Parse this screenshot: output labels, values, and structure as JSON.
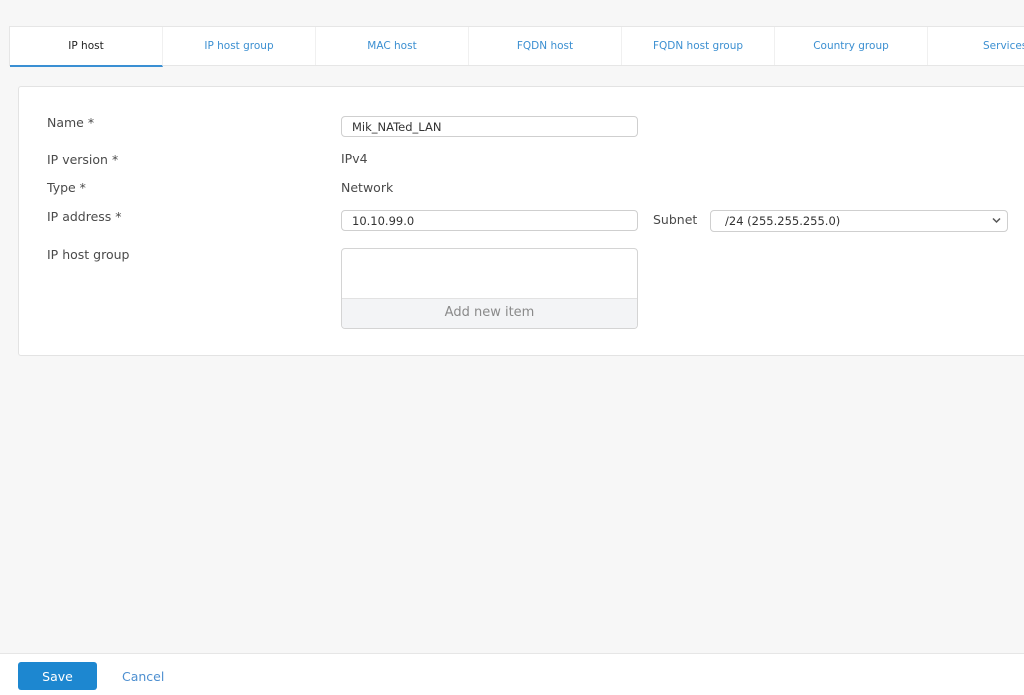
{
  "tabs": [
    {
      "label": "IP host",
      "active": true
    },
    {
      "label": "IP host group",
      "active": false
    },
    {
      "label": "MAC host",
      "active": false
    },
    {
      "label": "FQDN host",
      "active": false
    },
    {
      "label": "FQDN host group",
      "active": false
    },
    {
      "label": "Country group",
      "active": false
    },
    {
      "label": "Services",
      "active": false
    }
  ],
  "form": {
    "name": {
      "label": "Name *",
      "value": "Mik_NATed_LAN"
    },
    "ip_version": {
      "label": "IP version *",
      "value": "IPv4"
    },
    "type": {
      "label": "Type *",
      "value": "Network"
    },
    "ip_address": {
      "label": "IP address *",
      "value": "10.10.99.0"
    },
    "subnet": {
      "label": "Subnet",
      "selected": "/24 (255.255.255.0)"
    },
    "ip_host_group": {
      "label": "IP host group",
      "add_label": "Add new item"
    }
  },
  "footer": {
    "save_label": "Save",
    "cancel_label": "Cancel"
  },
  "colors": {
    "accent": "#1d87d0",
    "tab_link": "#3b8fd1",
    "active_underline": "#3a8fd3"
  }
}
